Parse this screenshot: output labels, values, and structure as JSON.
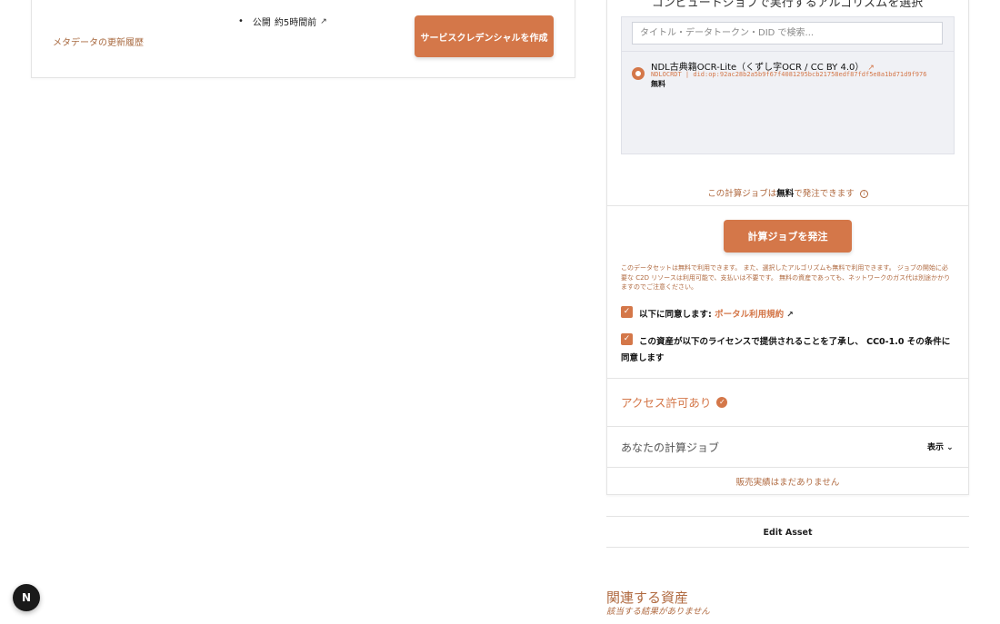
{
  "left": {
    "published_label": "公開",
    "published_time": "約5時間前",
    "metadata_history": "メタデータの更新履歴",
    "create_credential_button": "サービスクレデンシャルを作成"
  },
  "algo": {
    "heading": "コンピュートジョブで実行するアルゴリズムを選択",
    "search_placeholder": "タイトル・データトークン・DID で検索...",
    "item": {
      "name": "NDL古典籍OCR-Lite（くずし字OCR / CC BY 4.0）",
      "did": "NDLOCRDT | did:op:92ac28b2a5b9f67f4081295bcb21758edf87fdf5e8a1bd71d9f976",
      "price": "無料"
    }
  },
  "compute": {
    "free_note_prefix": "この計算ジョブは",
    "free_note_bold": "無料",
    "free_note_suffix": "で発注できます",
    "order_button": "計算ジョブを発注",
    "disclaimer": "このデータセットは無料で利用できます。 また、選択したアルゴリズムも無料で利用できます。 ジョブの開始に必要な C2D リソースは利用可能で、支払いは不要です。 無料の資産であっても、ネットワークのガス代は別途かかりますのでご注意ください。",
    "agree_terms_prefix": "以下に同意します: ",
    "agree_terms_link": "ポータル利用規約",
    "agree_license": "この資産が以下のライセンスで提供されることを了承し、 CC0-1.0 その条件に同意します"
  },
  "access": {
    "label": "アクセス許可あり"
  },
  "jobs": {
    "title": "あなたの計算ジョブ",
    "toggle": "表示",
    "no_sales": "販売実績はまだありません"
  },
  "edit": {
    "label": "Edit Asset"
  },
  "related": {
    "title": "関連する資産",
    "empty": "該当する結果がありません"
  },
  "badge": {
    "letter": "N"
  }
}
